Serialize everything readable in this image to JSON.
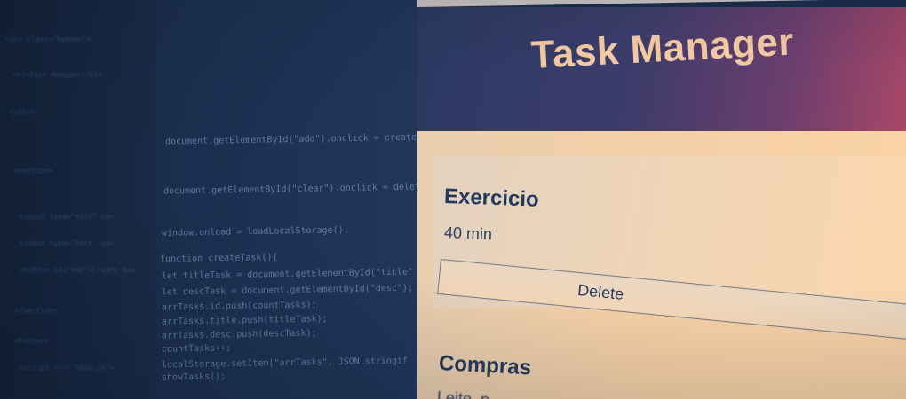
{
  "app": {
    "title": "Task Manager"
  },
  "tasks": [
    {
      "title": "Exercicio",
      "description": "40 min",
      "delete_label": "Delete"
    },
    {
      "title": "Compras",
      "description": "Leite, p..."
    }
  ],
  "editor": {
    "lines": [
      "document.getElementById(\"add\").onclick = createT",
      "document.getElementById(\"clear\").onclick = delet",
      "window.onload = loadLocalStorage();",
      "function createTask(){",
      "  let titleTask = document.getElementById(\"title\"",
      "  let descTask = document.getElementById(\"desc\");",
      "  arrTasks.id.push(countTasks);",
      "  arrTasks.title.push(titleTask);",
      "  arrTasks.desc.push(descTask);",
      "  countTasks++;",
      "  localStorage.setItem(\"arrTasks\", JSON.stringif",
      "  showTasks();"
    ],
    "faint_lines": [
      "<div class=\"header\">",
      "  <h1>Task Manager</h1>",
      "</div>",
      "<section>",
      "  <input type=\"text\" id=",
      "  <input type=\"text\" id=",
      "  <button id=\"add\">Create New",
      "</section>",
      "<footer>",
      "  <script src=\"main.js\">"
    ]
  },
  "colors": {
    "header_start": "#2a3a62",
    "header_end": "#a84767",
    "title_text": "#f2c9a2",
    "body_bg": "#f5cfa5",
    "task_text": "#233a5f",
    "editor_bg": "#1c2f50"
  }
}
